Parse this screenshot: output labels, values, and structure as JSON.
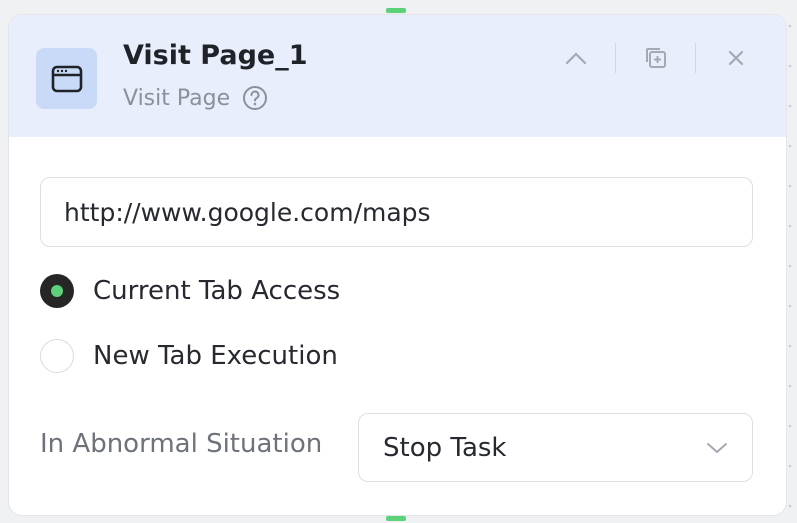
{
  "node": {
    "title": "Visit Page_1",
    "subtitle": "Visit Page",
    "icon": "browser-window-icon"
  },
  "header_actions": [
    "chevron-up-icon",
    "copy-add-icon",
    "close-icon"
  ],
  "url_field": {
    "value": "http://www.google.com/maps"
  },
  "tab_options": [
    {
      "label": "Current Tab Access",
      "selected": true
    },
    {
      "label": "New Tab Execution",
      "selected": false
    }
  ],
  "abnormal": {
    "label": "In Abnormal Situation",
    "selected": "Stop Task"
  },
  "colors": {
    "header_bg": "#e8eefb",
    "icon_bg": "#c9daf8",
    "accent_green": "#5bd17a",
    "radio_checked": "#262626"
  }
}
